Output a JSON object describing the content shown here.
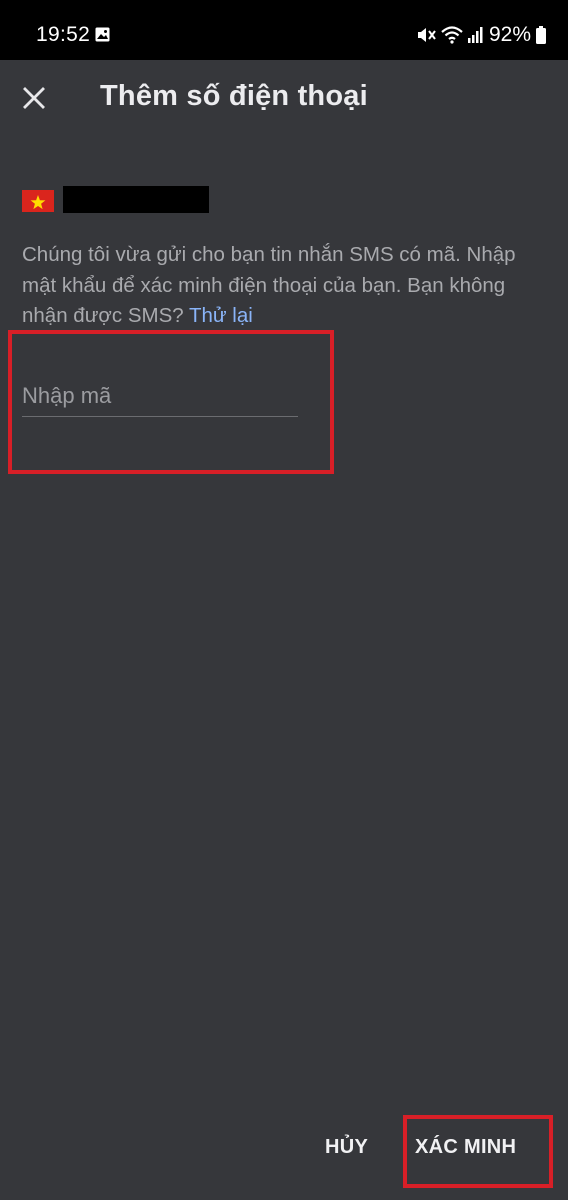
{
  "status_bar": {
    "time": "19:52",
    "battery": "92%",
    "icons": [
      "gallery-icon",
      "mute-icon",
      "wifi-icon",
      "signal-icon",
      "battery-icon"
    ]
  },
  "header": {
    "title": "Thêm số điện thoại",
    "close_icon": "close-icon"
  },
  "phone": {
    "flag": "vietnam-flag-icon",
    "number_redacted": true
  },
  "message": {
    "text": "Chúng tôi vừa gửi cho bạn tin nhắn SMS có mã. Nhập mật khẩu để xác minh điện thoại của bạn. Bạn không nhận được SMS?",
    "retry_label": "Thử lại"
  },
  "code_field": {
    "placeholder": "Nhập mã",
    "value": ""
  },
  "actions": {
    "cancel_label": "HỦY",
    "verify_label": "XÁC MINH"
  },
  "colors": {
    "background": "#36373b",
    "status_bar": "#000000",
    "link": "#8ab4f8",
    "highlight": "#d81f27"
  }
}
